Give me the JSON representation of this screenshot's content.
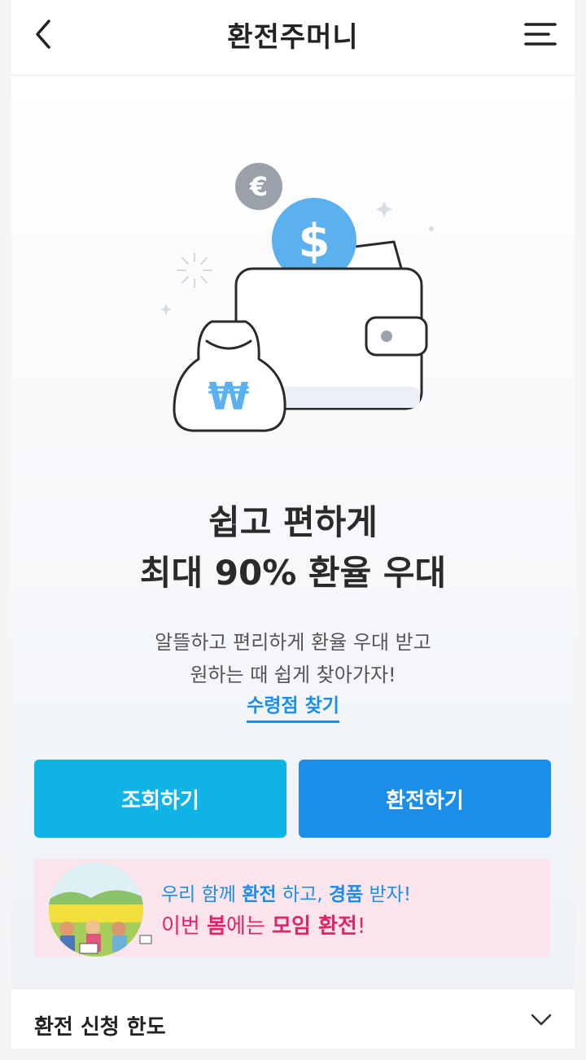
{
  "header": {
    "title": "환전주머니",
    "back_icon": "chevron-left-icon",
    "menu_icon": "hamburger-menu-icon"
  },
  "hero": {
    "illustration": {
      "coin_euro": "€",
      "coin_dollar": "$",
      "bag_symbol": "₩"
    },
    "headline_line1": "쉽고 편하게",
    "headline_line2": "최대 90% 환율 우대",
    "sub_line1": "알뜰하고 편리하게 환율 우대 받고",
    "sub_line2": "원하는 때 쉽게 찾아가자!",
    "find_link": "수령점 찾기"
  },
  "buttons": {
    "inquiry": "조회하기",
    "exchange": "환전하기"
  },
  "banner": {
    "line1_parts": [
      "우리 함께 ",
      "환전",
      " 하고, ",
      "경품",
      " 받자!"
    ],
    "line2_parts": [
      "이번 ",
      "봄",
      "에는 ",
      "모임 환전",
      "!"
    ]
  },
  "limit_section": {
    "label": "환전 신청 한도",
    "icon": "chevron-down-icon"
  },
  "colors": {
    "accent_blue": "#1a8ee8",
    "accent_cyan": "#10b3e6",
    "banner_bg": "#fbe4ec",
    "banner_pink": "#e0246a"
  }
}
